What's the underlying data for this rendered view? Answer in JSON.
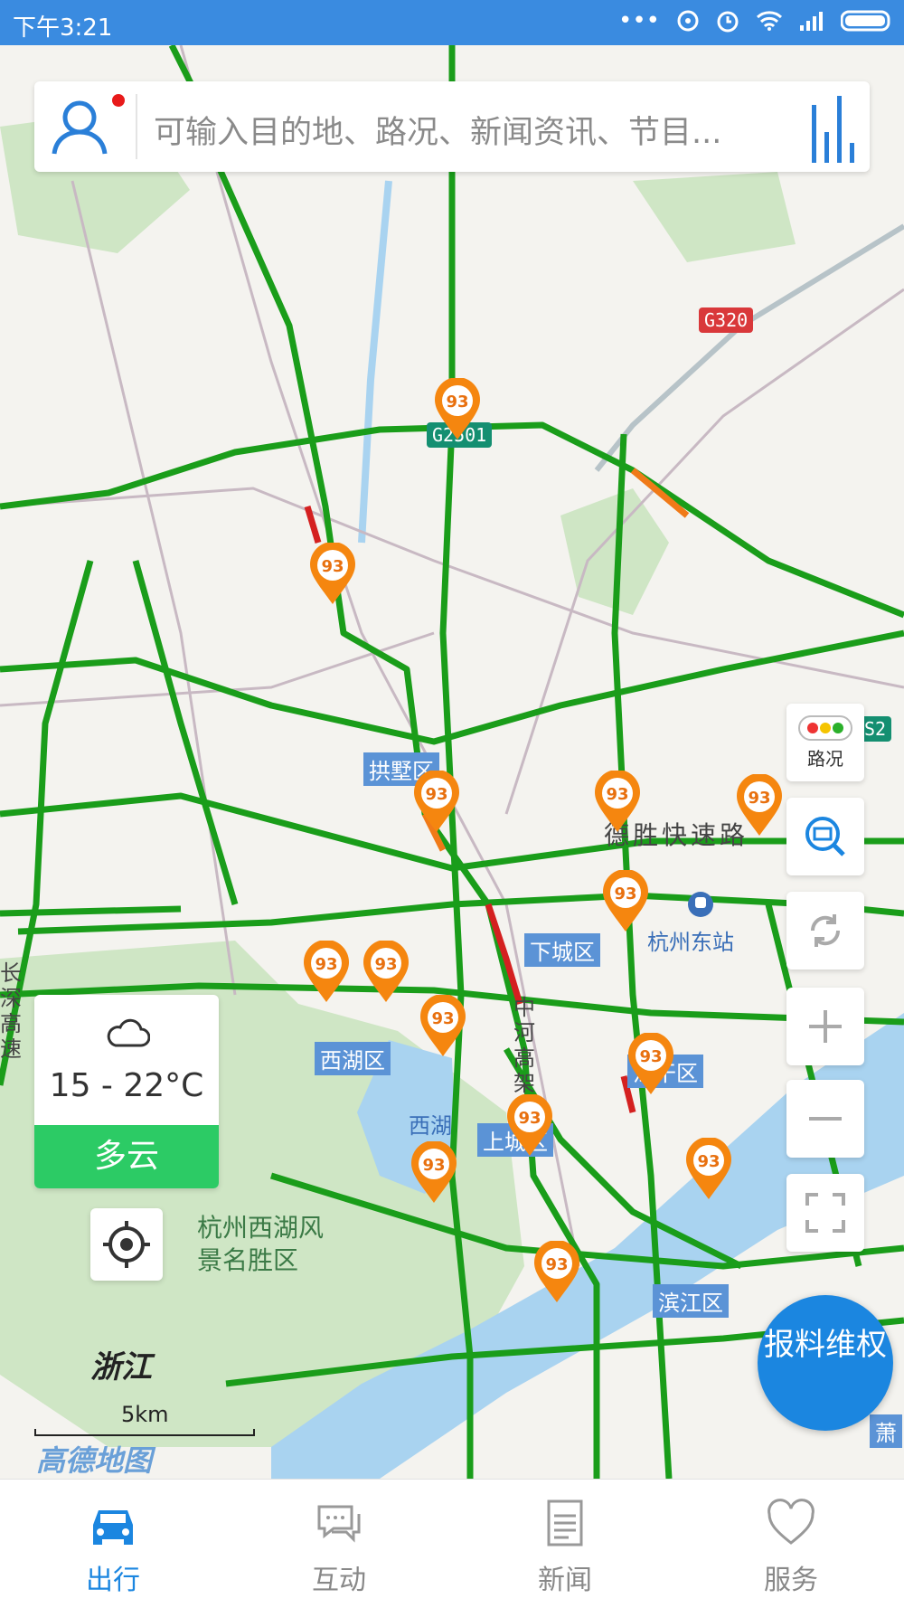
{
  "status_bar": {
    "time": "下午3:21"
  },
  "search": {
    "placeholder": "可输入目的地、路况、新闻资讯、节目..."
  },
  "map": {
    "road_signs": [
      "G320",
      "G2501",
      "S2"
    ],
    "districts": [
      "拱墅区",
      "下城区",
      "西湖区",
      "上城区",
      "滨江区",
      "江干区"
    ],
    "labels": {
      "road_deshen": "德胜快速路",
      "station": "杭州东站",
      "lake": "西湖",
      "scenic": "杭州西湖风景名胜区",
      "road_zhonghe": "中河高架",
      "road_changshen": "长深高速",
      "xiaoshan": "萧",
      "scale": "5km",
      "brand": "高德地图",
      "zhejiang": "浙江"
    },
    "pin_label": "93"
  },
  "side_buttons": {
    "traffic_label": "路况"
  },
  "weather": {
    "temperature": "15 - 22°C",
    "condition": "多云"
  },
  "report_button": {
    "label": "报料维权"
  },
  "tabs": [
    {
      "label": "出行",
      "icon": "car-icon"
    },
    {
      "label": "互动",
      "icon": "chat-icon"
    },
    {
      "label": "新闻",
      "icon": "newspaper-icon"
    },
    {
      "label": "服务",
      "icon": "heart-service-icon"
    }
  ],
  "colors": {
    "accent": "#1b86e0",
    "status_bar": "#3a8be0",
    "road_green": "#1a9d1a",
    "pin_orange": "#f5860f",
    "weather_green": "#2ccb65"
  }
}
